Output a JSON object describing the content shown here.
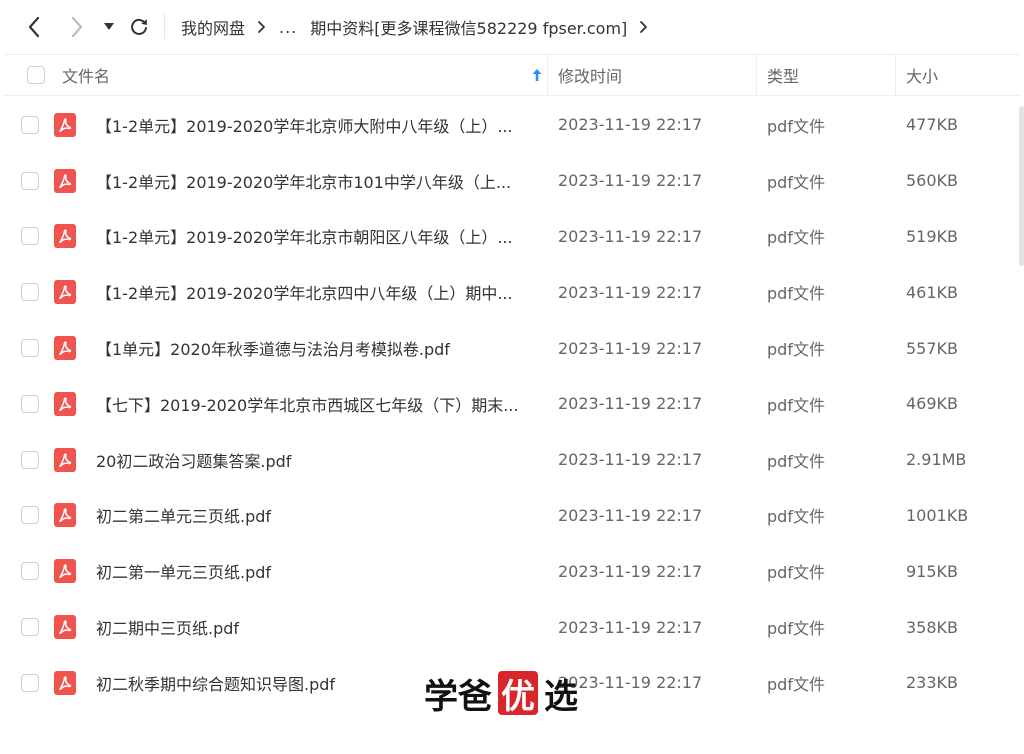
{
  "nav": {
    "back_icon": "chevron-left-icon",
    "forward_icon": "chevron-right-icon",
    "dropdown_icon": "caret-down-icon",
    "refresh_icon": "refresh-icon"
  },
  "breadcrumb": {
    "root": "我的网盘",
    "ellipsis": "...",
    "current": "期中资料[更多课程微信582229 fpser.com]"
  },
  "table": {
    "headers": {
      "name": "文件名",
      "modified": "修改时间",
      "type": "类型",
      "size": "大小"
    },
    "sort_icon": "arrow-up-icon",
    "rows": [
      {
        "name": "【1-2单元】2019-2020学年北京师大附中八年级（上）...",
        "modified": "2023-11-19 22:17",
        "type": "pdf文件",
        "size": "477KB"
      },
      {
        "name": "【1-2单元】2019-2020学年北京市101中学八年级（上...",
        "modified": "2023-11-19 22:17",
        "type": "pdf文件",
        "size": "560KB"
      },
      {
        "name": "【1-2单元】2019-2020学年北京市朝阳区八年级（上）...",
        "modified": "2023-11-19 22:17",
        "type": "pdf文件",
        "size": "519KB"
      },
      {
        "name": "【1-2单元】2019-2020学年北京四中八年级（上）期中...",
        "modified": "2023-11-19 22:17",
        "type": "pdf文件",
        "size": "461KB"
      },
      {
        "name": "【1单元】2020年秋季道德与法治月考模拟卷.pdf",
        "modified": "2023-11-19 22:17",
        "type": "pdf文件",
        "size": "557KB"
      },
      {
        "name": "【七下】2019-2020学年北京市西城区七年级（下）期末...",
        "modified": "2023-11-19 22:17",
        "type": "pdf文件",
        "size": "469KB"
      },
      {
        "name": "20初二政治习题集答案.pdf",
        "modified": "2023-11-19 22:17",
        "type": "pdf文件",
        "size": "2.91MB"
      },
      {
        "name": "初二第二单元三页纸.pdf",
        "modified": "2023-11-19 22:17",
        "type": "pdf文件",
        "size": "1001KB"
      },
      {
        "name": "初二第一单元三页纸.pdf",
        "modified": "2023-11-19 22:17",
        "type": "pdf文件",
        "size": "915KB"
      },
      {
        "name": "初二期中三页纸.pdf",
        "modified": "2023-11-19 22:17",
        "type": "pdf文件",
        "size": "358KB"
      },
      {
        "name": "初二秋季期中综合题知识导图.pdf",
        "modified": "2023-11-19 22:17",
        "type": "pdf文件",
        "size": "233KB"
      }
    ]
  },
  "watermark": {
    "part1": "学爸",
    "part2": "优",
    "part3": "选"
  },
  "colors": {
    "pdf_icon": "#f0544f",
    "sort_arrow": "#2f8cff",
    "watermark_box": "#d8262b"
  }
}
